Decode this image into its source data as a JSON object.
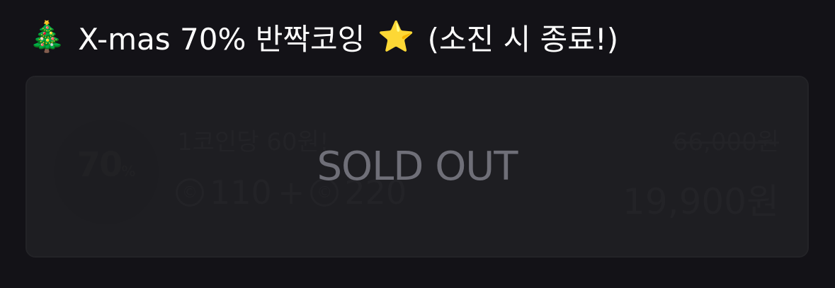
{
  "header": {
    "tree_emoji": "🎄",
    "title_text": "X-mas 70% 반짝코잉",
    "star_emoji": "⭐",
    "suffix_text": "(소진 시 종료!)"
  },
  "product": {
    "discount_number": "70",
    "discount_percent_sign": "%",
    "unit_price_text": "1코인당 60원!",
    "coin_symbol": "©",
    "coin_amount_1": "110",
    "plus": "+",
    "coin_amount_2": "220",
    "original_price": "66,000원",
    "sale_price": "19,900원",
    "sold_out_label": "SOLD OUT"
  },
  "colors": {
    "background": "#131217",
    "card": "#1c1c20",
    "sold_out_text": "#6f6f78"
  }
}
